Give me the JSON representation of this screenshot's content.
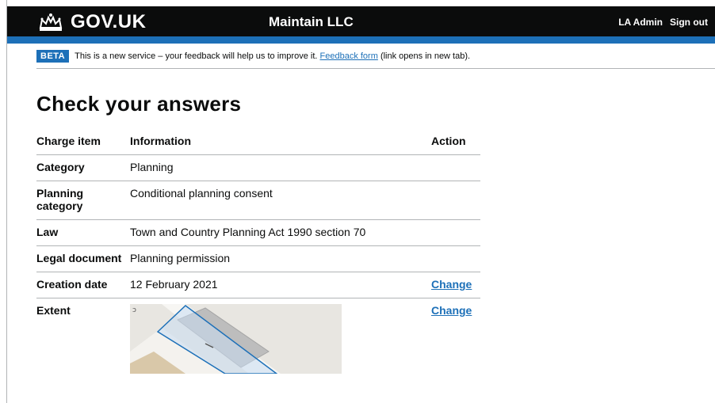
{
  "header": {
    "logo_text": "GOV.UK",
    "service_name": "Maintain LLC",
    "nav": [
      "LA Admin",
      "Sign out"
    ]
  },
  "beta_banner": {
    "tag": "BETA",
    "text_before": "This is a new service – your feedback will help us to improve it.",
    "link": "Feedback form",
    "text_after": "(link opens in new tab)."
  },
  "page_title": "Check your answers",
  "table": {
    "headers": [
      "Charge item",
      "Information",
      "Action"
    ],
    "rows": [
      {
        "key": "Category",
        "value": "Planning",
        "action": ""
      },
      {
        "key": "Planning category",
        "value": "Conditional planning consent",
        "action": ""
      },
      {
        "key": "Law",
        "value": "Town and Country Planning Act 1990 section 70",
        "action": ""
      },
      {
        "key": "Legal document",
        "value": "Planning permission",
        "action": ""
      },
      {
        "key": "Creation date",
        "value": "12 February 2021",
        "action": "Change"
      },
      {
        "key": "Extent",
        "value": "",
        "action": "Change"
      }
    ]
  },
  "colors": {
    "header_bg": "#0b0c0c",
    "accent_blue": "#1d70b8",
    "extent_fill": "#c9dcf2",
    "extent_border": "#1d70b8"
  }
}
